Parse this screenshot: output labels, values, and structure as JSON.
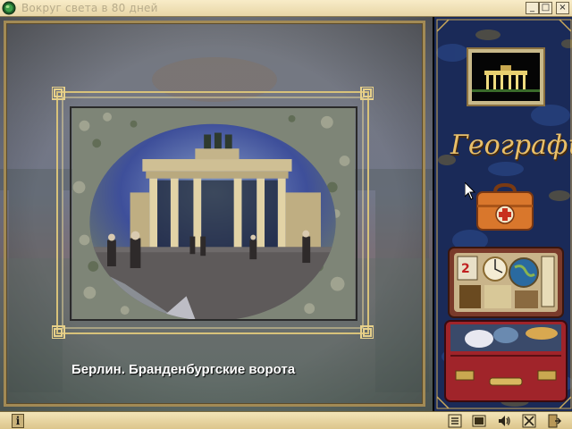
{
  "window": {
    "title": "Вокруг света в 80 дней"
  },
  "photo": {
    "caption": "Берлин. Бранденбургские ворота"
  },
  "panel": {
    "section_label": "География"
  },
  "icons": {
    "app": "globe-icon",
    "minimize": "minimize-icon",
    "maximize": "maximize-icon",
    "close": "close-icon",
    "info": "info-icon",
    "text": "text-icon",
    "image": "image-icon",
    "sound": "speaker-icon",
    "stop": "stop-icon",
    "exit": "exit-icon",
    "cursor": "arrow-cursor-icon",
    "medkit": "first-aid-kit-icon",
    "suitcase": "travel-suitcase-icon"
  },
  "colors": {
    "title_bar": "#e8d6a6",
    "status_bar": "#dcc58c",
    "panel_bg": "#16224a",
    "accent_gold": "#e9c06a",
    "frame_gold": "#d8c27a"
  },
  "glyphs": {
    "minimize": "_",
    "maximize": "□",
    "close": "×",
    "info": "i"
  }
}
